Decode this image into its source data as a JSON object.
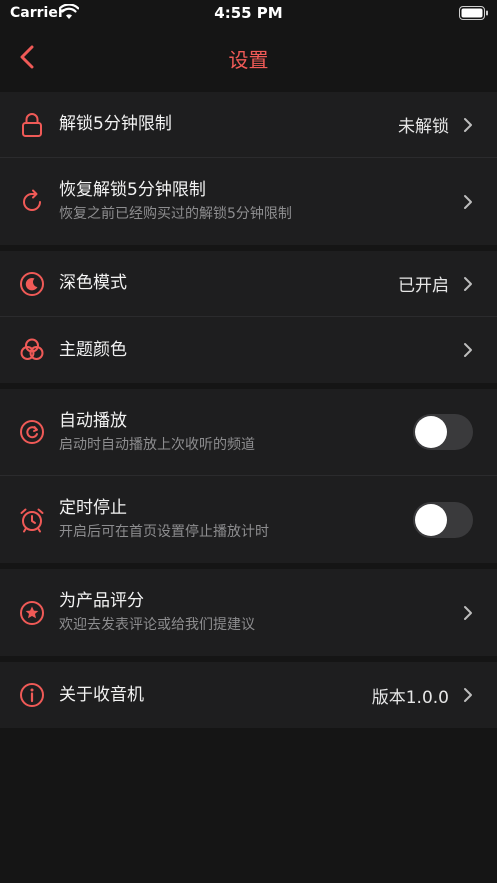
{
  "status_bar": {
    "carrier": "Carrier",
    "time": "4:55 PM"
  },
  "nav": {
    "title": "设置"
  },
  "accent_color": "#f05a57",
  "groups": [
    {
      "rows": [
        {
          "icon": "lock-icon",
          "title": "解锁5分钟限制",
          "value": "未解锁"
        },
        {
          "icon": "refresh-icon",
          "title": "恢复解锁5分钟限制",
          "subtitle": "恢复之前已经购买过的解锁5分钟限制"
        }
      ]
    },
    {
      "rows": [
        {
          "icon": "moon-icon",
          "title": "深色模式",
          "value": "已开启"
        },
        {
          "icon": "color-circles-icon",
          "title": "主题颜色"
        }
      ]
    },
    {
      "rows": [
        {
          "icon": "auto-play-icon",
          "title": "自动播放",
          "subtitle": "启动时自动播放上次收听的频道",
          "toggle_on": false
        },
        {
          "icon": "alarm-clock-icon",
          "title": "定时停止",
          "subtitle": "开启后可在首页设置停止播放计时",
          "toggle_on": false
        }
      ]
    },
    {
      "rows": [
        {
          "icon": "star-icon",
          "title": "为产品评分",
          "subtitle": "欢迎去发表评论或给我们提建议"
        }
      ]
    },
    {
      "rows": [
        {
          "icon": "info-icon",
          "title": "关于收音机",
          "value": "版本1.0.0"
        }
      ]
    }
  ]
}
